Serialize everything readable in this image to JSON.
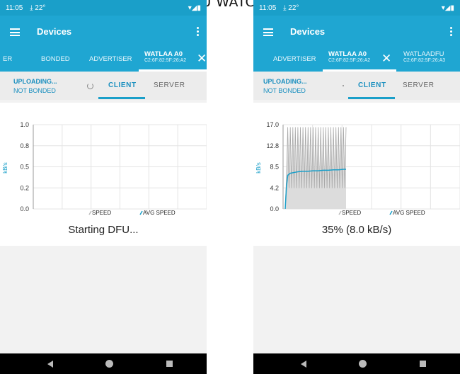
{
  "caption": "TOUCH PHONE DFU WATCH DURING UPDATE",
  "phones": [
    {
      "status_time": "11:05",
      "status_temp": "22°",
      "app_title": "Devices",
      "tabs": [
        "ER",
        "BONDED",
        "ADVERTISER"
      ],
      "active_tab": {
        "name": "WATLAA A0",
        "address": "C2:6F:82:5F:26:A2"
      },
      "status_line1": "UPLOADING...",
      "status_line2": "NOT BONDED",
      "subtab_client": "CLIENT",
      "subtab_server": "SERVER",
      "progress_text": "Starting DFU..."
    },
    {
      "status_time": "11:05",
      "status_temp": "22°",
      "app_title": "Devices",
      "tabs": [
        "ADVERTISER"
      ],
      "active_tab": {
        "name": "WATLAA A0",
        "address": "C2:6F:82:5F:26:A2"
      },
      "next_tab": {
        "name": "WATLAADFU",
        "address": "C2:6F:82:5F:26:A3"
      },
      "status_line1": "UPLOADING...",
      "status_line2": "NOT BONDED",
      "subtab_client": "CLIENT",
      "subtab_server": "SERVER",
      "progress_text": "35% (8.0 kB/s)"
    }
  ],
  "chart_data": [
    {
      "type": "line",
      "ylabel": "kB/s",
      "ylim": [
        0,
        1.0
      ],
      "yticks": [
        "1.0",
        "0.8",
        "0.5",
        "0.2",
        "0.0"
      ],
      "legend": [
        "SPEED",
        "AVG SPEED"
      ],
      "legend_placement": "bottom",
      "grid": true,
      "series": []
    },
    {
      "type": "line",
      "ylabel": "kB/s",
      "ylim": [
        0,
        17.0
      ],
      "yticks": [
        "17.0",
        "12.8",
        "8.5",
        "4.2",
        "0.0"
      ],
      "legend": [
        "SPEED",
        "AVG SPEED"
      ],
      "legend_placement": "bottom",
      "grid": true,
      "series": [
        {
          "name": "SPEED",
          "x": [
            0,
            1,
            2,
            3,
            4,
            5,
            6,
            7,
            8,
            9,
            10,
            11,
            12,
            13,
            14,
            15,
            16,
            17,
            18,
            19,
            20,
            21,
            22,
            23,
            24,
            25,
            26,
            27,
            28,
            29,
            30,
            31,
            32,
            33,
            34,
            35,
            36,
            37,
            38,
            39,
            40,
            41,
            42,
            43,
            44,
            45,
            46,
            47,
            48
          ],
          "values": [
            0,
            6.5,
            16.5,
            4.2,
            16.5,
            4.2,
            16.5,
            4.2,
            16.5,
            4.2,
            16.5,
            4.2,
            16.5,
            4.2,
            16.5,
            4.2,
            16.5,
            4.2,
            16.5,
            4.2,
            16.5,
            4.2,
            16.5,
            4.2,
            16.5,
            4.2,
            16.5,
            4.2,
            16.5,
            4.2,
            16.5,
            4.2,
            16.5,
            4.2,
            16.5,
            4.2,
            16.5,
            4.2,
            16.5,
            4.2,
            16.5,
            4.2,
            16.5,
            4.2,
            16.5,
            4.2,
            16.5,
            4.2,
            16.5
          ]
        },
        {
          "name": "AVG SPEED",
          "x": [
            0,
            1,
            2,
            3,
            4,
            6,
            8,
            10,
            14,
            18,
            22,
            26,
            30,
            34,
            38,
            42,
            46,
            48
          ],
          "values": [
            0,
            4.5,
            6.8,
            7.0,
            7.2,
            7.3,
            7.4,
            7.5,
            7.6,
            7.6,
            7.7,
            7.7,
            7.8,
            7.8,
            7.9,
            7.9,
            8.0,
            8.0
          ]
        }
      ]
    }
  ]
}
